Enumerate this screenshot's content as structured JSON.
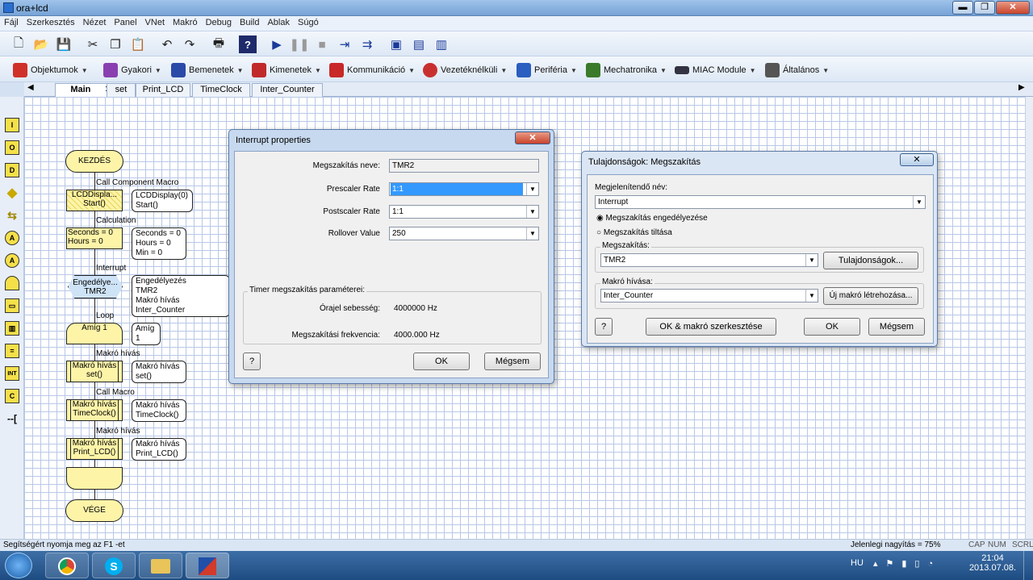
{
  "window": {
    "title": "ora+lcd",
    "buttons": [
      "▬",
      "❐",
      "✕"
    ]
  },
  "menu": [
    "Fájl",
    "Szerkesztés",
    "Nézet",
    "Panel",
    "VNet",
    "Makró",
    "Debug",
    "Build",
    "Ablak",
    "Súgó"
  ],
  "toolbar_groups": [
    {
      "label": "Objektumok",
      "icon": "objects-icon",
      "color": "#d0302a"
    },
    {
      "label": "Gyakori",
      "icon": "common-icon",
      "color": "#8a3fb0"
    },
    {
      "label": "Bemenetek",
      "icon": "inputs-icon",
      "color": "#2a4aa8"
    },
    {
      "label": "Kimenetek",
      "icon": "outputs-icon",
      "color": "#c02a2a"
    },
    {
      "label": "Kommunikáció",
      "icon": "communication-icon",
      "color": "#c82828"
    },
    {
      "label": "Vezetéknélküli",
      "icon": "wireless-icon",
      "color": "#c83030"
    },
    {
      "label": "Periféria",
      "icon": "peripheral-icon",
      "color": "#2a5ec0"
    },
    {
      "label": "Mechatronika",
      "icon": "mechatronics-icon",
      "color": "#3a7a2a"
    },
    {
      "label": "MIAC Module",
      "icon": "miac-icon",
      "color": "#334"
    },
    {
      "label": "Általános",
      "icon": "general-icon",
      "color": "#555"
    }
  ],
  "tabs": [
    "Main",
    "set",
    "Print_LCD",
    "TimeClock",
    "Inter_Counter"
  ],
  "flowchart": {
    "start": "KEZDÉS",
    "end": "VÉGE",
    "blocks": [
      {
        "caption": "Call Component Macro",
        "text": "LCDDispla... Start()",
        "note": [
          "LCDDisplay(0)",
          "Start()"
        ]
      },
      {
        "caption": "Calculation",
        "text": "Seconds = 0 Hours = 0",
        "note": [
          "Seconds = 0",
          "Hours = 0",
          "Min = 0"
        ]
      },
      {
        "caption": "Interrupt",
        "text": "Engedélye... TMR2",
        "note": [
          "Engedélyezés",
          "TMR2",
          "Makró hívás Inter_Counter"
        ]
      },
      {
        "caption": "Loop",
        "text": "Amíg 1",
        "note": [
          "Amíg",
          "1"
        ]
      },
      {
        "caption": "Makró hívás",
        "text": "Makró hívás set()",
        "note": [
          "Makró hívás",
          "set()"
        ]
      },
      {
        "caption": "Call Macro",
        "text": "Makró hívás TimeClock()",
        "note": [
          "Makró hívás",
          "TimeClock()"
        ]
      },
      {
        "caption": "Makró hívás",
        "text": "Makró hívás Print_LCD()",
        "note": [
          "Makró hívás",
          "Print_LCD()"
        ]
      }
    ]
  },
  "interrupt_dialog": {
    "title": "Interrupt properties",
    "name_label": "Megszakítás neve:",
    "name_value": "TMR2",
    "prescaler_label": "Prescaler Rate",
    "prescaler_value": "1:1",
    "postscaler_label": "Postscaler Rate",
    "postscaler_value": "1:1",
    "rollover_label": "Rollover Value",
    "rollover_value": "250",
    "group_title": "Timer megszakítás paraméterei:",
    "clock_label": "Órajel sebesség:",
    "clock_value": "4000000 Hz",
    "freq_label": "Megszakítási frekvencia:",
    "freq_value": "4000.000 Hz",
    "help": "?",
    "ok": "OK",
    "cancel": "Mégsem"
  },
  "props_dialog": {
    "title": "Tulajdonságok: Megszakítás",
    "display_name_label": "Megjelenítendő név:",
    "display_name_value": "Interrupt",
    "radio_enable": "Megszakítás engedélyezése",
    "radio_disable": "Megszakítás tiltása",
    "interrupt_group": "Megszakítás:",
    "interrupt_value": "TMR2",
    "props_button": "Tulajdonságok...",
    "macro_group": "Makró hívása:",
    "macro_value": "Inter_Counter",
    "new_macro_button": "Új makró létrehozása...",
    "help": "?",
    "ok_edit": "OK & makró szerkesztése",
    "ok": "OK",
    "cancel": "Mégsem"
  },
  "status": {
    "help_text": "Segítségért nyomja meg az F1 -et",
    "zoom": "Jelenlegi nagyítás = 75%",
    "caps": "CAP",
    "num": "NUM",
    "scrl": "SCRL"
  },
  "taskbar": {
    "lang": "HU",
    "time": "21:04",
    "date": "2013.07.08."
  }
}
